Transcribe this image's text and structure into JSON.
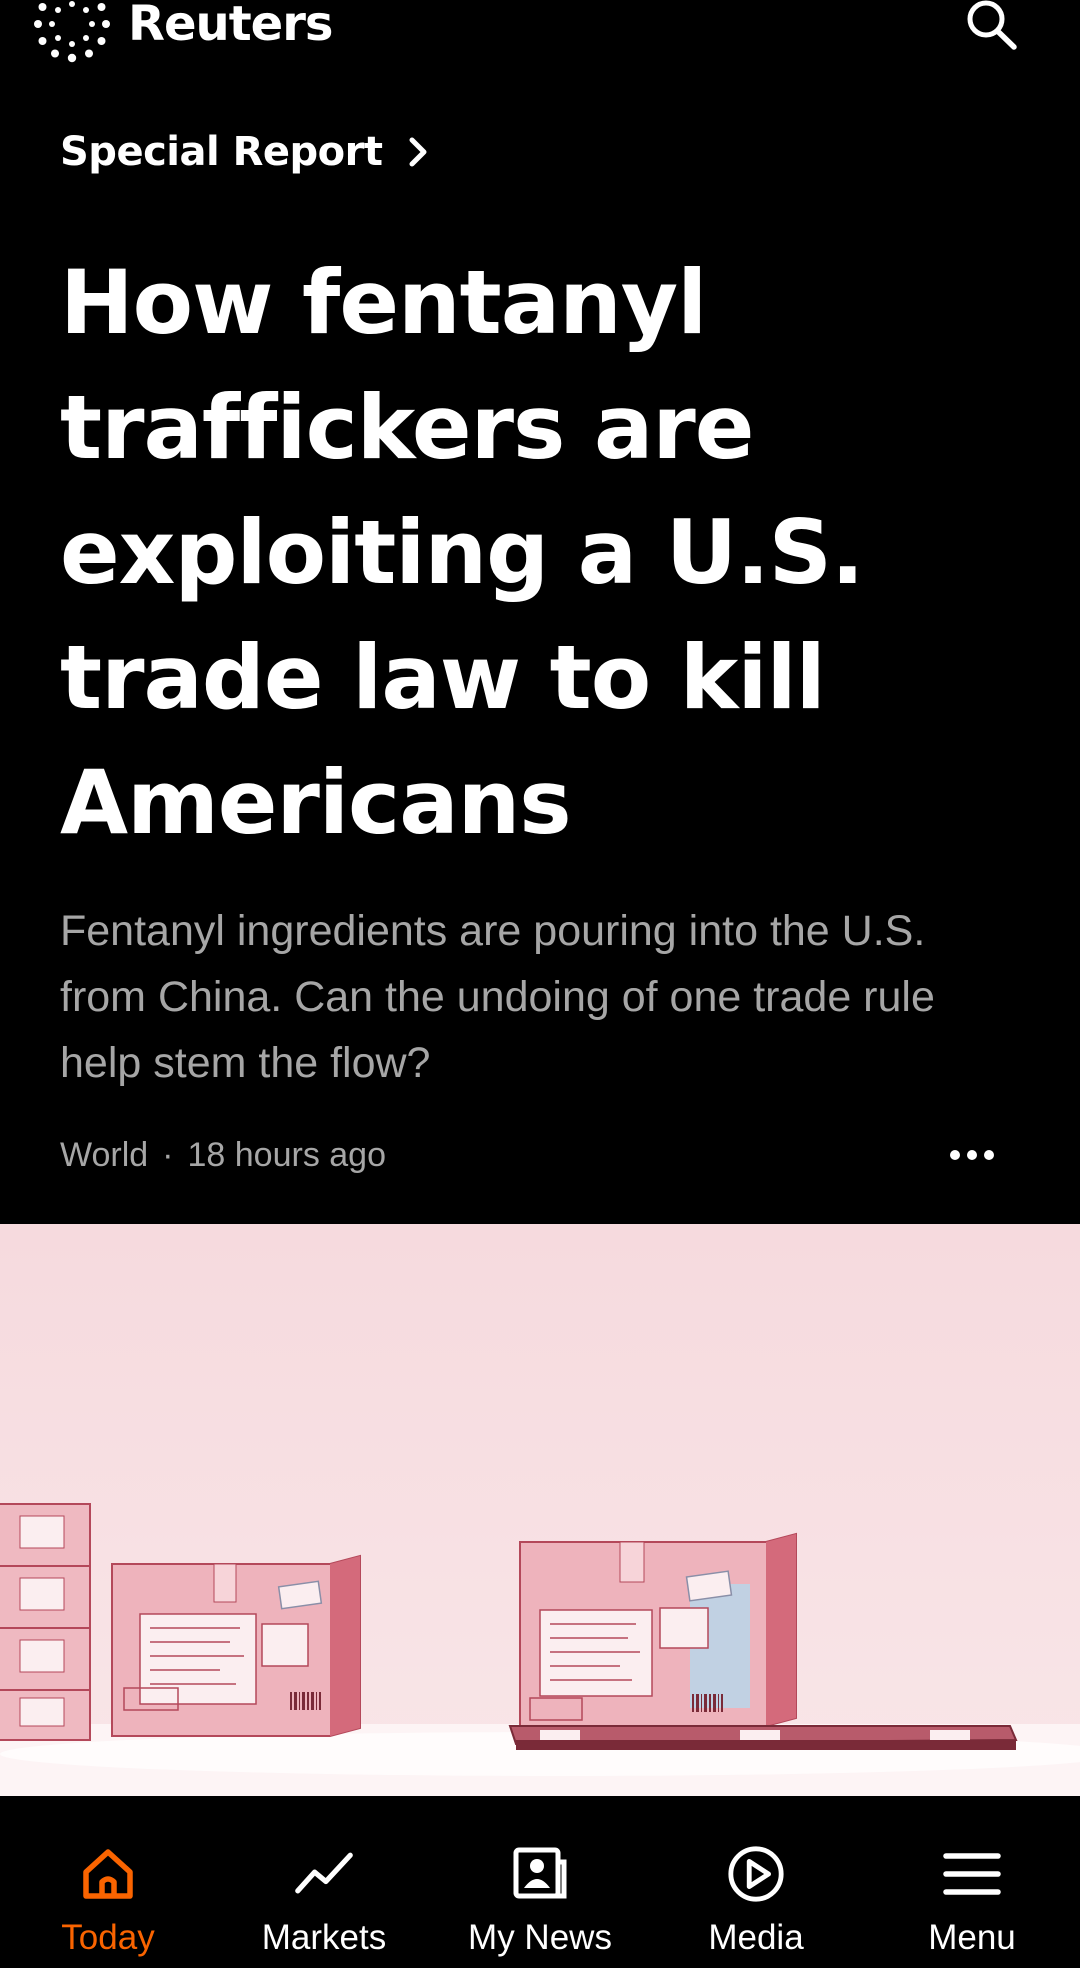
{
  "header": {
    "brand_name": "Reuters",
    "logo_icon": "reuters-dotted-circle-logo",
    "search_icon": "search-icon"
  },
  "article": {
    "kicker": "Special Report",
    "headline": "How fentanyl traffickers are exploiting a U.S. trade law to kill Americans",
    "dek": "Fentanyl ingredients are pouring into the U.S. from China. Can the undoing of one trade rule help stem the flow?",
    "section": "World",
    "separator": "·",
    "timestamp": "18 hours ago"
  },
  "hero": {
    "alt_icon": "shipping-boxes-illustration",
    "background_color": "#f6dbe0"
  },
  "bottom_nav": {
    "items": [
      {
        "label": "Today",
        "icon": "home-icon",
        "active": true
      },
      {
        "label": "Markets",
        "icon": "trend-line-icon",
        "active": false
      },
      {
        "label": "My News",
        "icon": "my-news-icon",
        "active": false
      },
      {
        "label": "Media",
        "icon": "play-circle-icon",
        "active": false
      },
      {
        "label": "Menu",
        "icon": "hamburger-menu-icon",
        "active": false
      }
    ]
  },
  "colors": {
    "background": "#000000",
    "text_primary": "#ffffff",
    "text_secondary": "#a6a6a6",
    "accent": "#fa6400"
  }
}
